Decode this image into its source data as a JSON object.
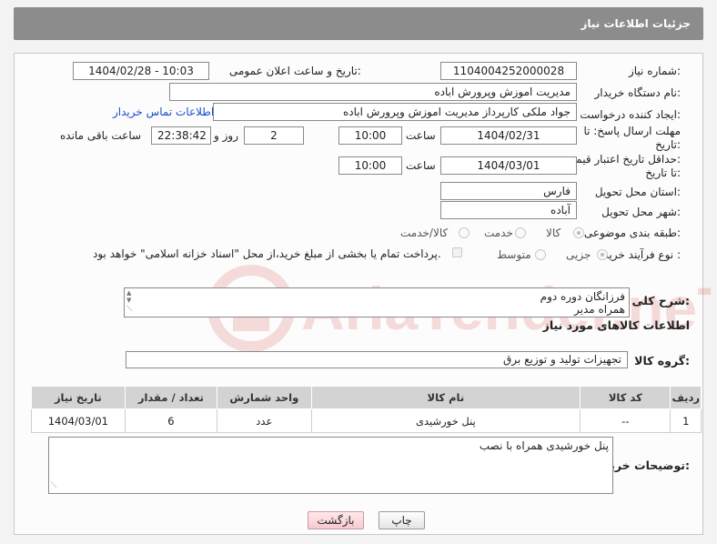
{
  "header": {
    "title": "جزئیات اطلاعات نیاز"
  },
  "form": {
    "need_number": {
      "label": "شماره نیاز:",
      "value": "1104004252000028"
    },
    "announce_datetime": {
      "label": "تاریخ و ساعت اعلان عمومی:",
      "value": "1404/02/28 - 10:03"
    },
    "buyer_org": {
      "label": "نام دستگاه خریدار:",
      "value": "مدیریت اموزش وپرورش اباده"
    },
    "requester": {
      "label": "ایجاد کننده درخواست:",
      "value": "جواد ملکی کارپرداز مدیریت اموزش وپرورش اباده",
      "contact_link": "اطلاعات تماس خریدار"
    },
    "reply_deadline": {
      "label_line1": "مهلت ارسال پاسخ: تا",
      "label_line2": "تاریخ:",
      "date": "1404/02/31",
      "time_label": "ساعت",
      "time": "10:00",
      "days": "2",
      "days_label": "روز و",
      "remaining": "22:38:42",
      "remaining_label": "ساعت باقی مانده"
    },
    "price_validity": {
      "label_line1": "حداقل تاریخ اعتبار قیمت:",
      "label_line2": "تا تاریخ:",
      "date": "1404/03/01",
      "time_label": "ساعت",
      "time": "10:00"
    },
    "delivery_province": {
      "label": "استان محل تحویل:",
      "value": "فارس"
    },
    "delivery_city": {
      "label": "شهر محل تحویل:",
      "value": "آباده"
    },
    "category": {
      "label": "طبقه بندی موضوعی:",
      "options": [
        "کالا",
        "خدمت",
        "کالا/خدمت"
      ],
      "selected": "کالا"
    },
    "purchase_process": {
      "label": "نوع فرآیند خرید :",
      "options": [
        "جزیی",
        "متوسط"
      ],
      "selected": "جزیی",
      "payment_note": "پرداخت تمام یا بخشی از مبلغ خرید،از محل \"اسناد خزانه اسلامی\" خواهد بود."
    },
    "description": {
      "label": "شرح کلی نیاز:",
      "line1": "فرزانگان دوره دوم",
      "line2": "همراه مدیر"
    }
  },
  "goods": {
    "section_title": "اطلاعات کالاهای مورد نیاز",
    "group_label": "گروه کالا:",
    "group_value": "تجهیزات تولید و توزیع برق",
    "columns": [
      "ردیف",
      "کد کالا",
      "نام کالا",
      "واحد شمارش",
      "تعداد / مقدار",
      "تاریخ نیاز"
    ],
    "rows": [
      {
        "row": "1",
        "code": "--",
        "name": "پنل خورشیدی",
        "unit": "عدد",
        "qty": "6",
        "date": "1404/03/01"
      }
    ]
  },
  "buyer_notes": {
    "label": "توضیحات خریدار:",
    "value": "پنل خورشیدی همراه با نصب"
  },
  "buttons": {
    "print": "چاپ",
    "back": "بازگشت"
  },
  "watermark_text": "AriaTender.neT"
}
